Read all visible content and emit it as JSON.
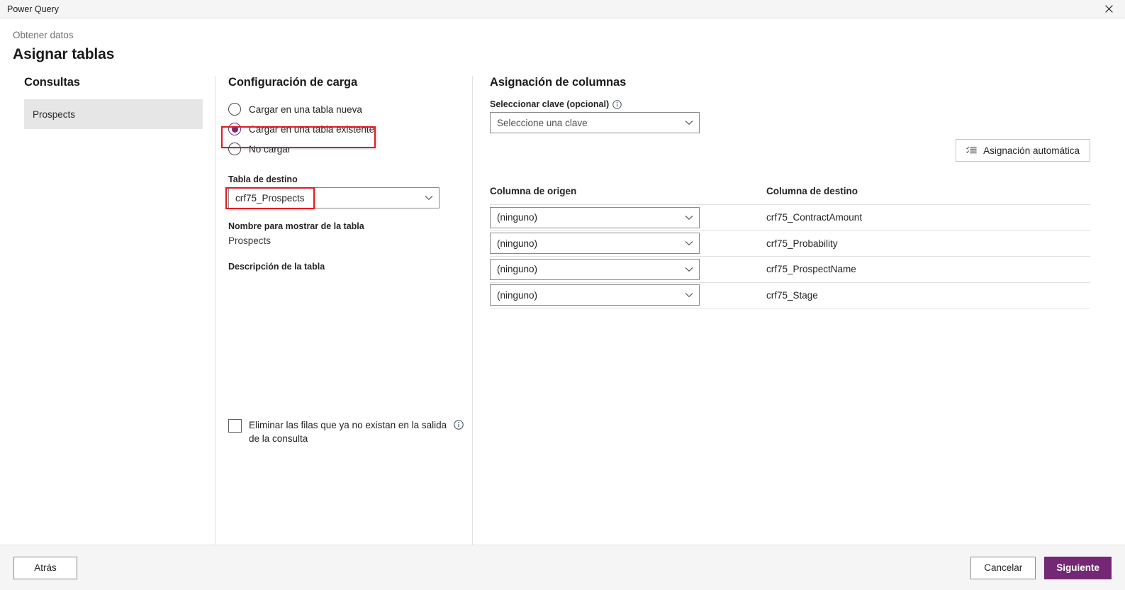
{
  "window": {
    "title": "Power Query",
    "close_icon": "close-icon"
  },
  "header": {
    "breadcrumb": "Obtener datos",
    "title": "Asignar tablas"
  },
  "queries": {
    "section_title": "Consultas",
    "items": [
      {
        "label": "Prospects",
        "selected": true
      }
    ]
  },
  "load_settings": {
    "section_title": "Configuración de carga",
    "radio_options": [
      {
        "label": "Cargar en una tabla nueva",
        "checked": false
      },
      {
        "label": "Cargar en una tabla existente",
        "checked": true
      },
      {
        "label": "No cargar",
        "checked": false
      }
    ],
    "destination_table": {
      "label": "Tabla de destino",
      "value": "crf75_Prospects",
      "chevron_icon": "chevron-down-icon"
    },
    "display_name": {
      "label": "Nombre para mostrar de la tabla",
      "value": "Prospects"
    },
    "description": {
      "label": "Descripción de la tabla",
      "value": ""
    },
    "delete_rows_checkbox": {
      "label": "Eliminar las filas que ya no existan en la salida de la consulta",
      "checked": false,
      "info_icon": "info-icon"
    }
  },
  "column_mapping": {
    "section_title": "Asignación de columnas",
    "key_select": {
      "label": "Seleccionar clave (opcional)",
      "info_icon": "info-icon",
      "placeholder": "Seleccione una clave",
      "chevron_icon": "chevron-down-icon"
    },
    "automap_button": {
      "label": "Asignación automática",
      "icon": "checklist-icon"
    },
    "table": {
      "headers": [
        "Columna de origen",
        "Columna de destino"
      ],
      "rows": [
        {
          "source": "(ninguno)",
          "destination": "crf75_ContractAmount"
        },
        {
          "source": "(ninguno)",
          "destination": "crf75_Probability"
        },
        {
          "source": "(ninguno)",
          "destination": "crf75_ProspectName"
        },
        {
          "source": "(ninguno)",
          "destination": "crf75_Stage"
        }
      ]
    }
  },
  "footer": {
    "back_label": "Atrás",
    "cancel_label": "Cancelar",
    "next_label": "Siguiente"
  },
  "annotations": {
    "accent_color": "#742774",
    "highlight_color": "#e01b24",
    "boxes": [
      {
        "target": "radio-cargar-tabla-existente"
      },
      {
        "target": "destination-table-value"
      }
    ]
  }
}
